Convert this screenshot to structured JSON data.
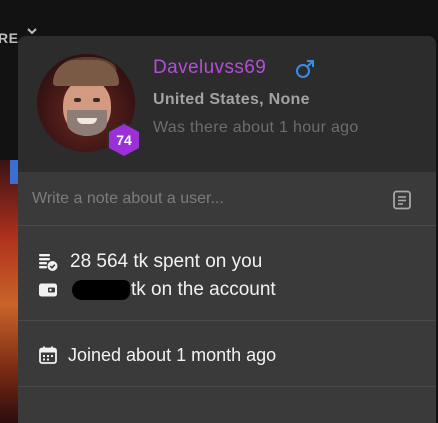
{
  "background": {
    "tab_label": "RE"
  },
  "profile": {
    "username": "Daveluvss69",
    "level": "74",
    "location": "United States, None",
    "last_seen": "Was there about 1 hour ago",
    "gender_icon": "male-symbol-icon",
    "avatar_icon": "user-avatar-photo"
  },
  "note": {
    "placeholder": "Write a note about a user...",
    "value": "",
    "icon": "note-icon"
  },
  "stats": {
    "spent_text": "28 564 tk spent on you",
    "account_suffix": "tk on the account",
    "spent_icon": "coins-icon",
    "account_icon": "wallet-icon"
  },
  "joined": {
    "text": "Joined about 1 month ago",
    "icon": "calendar-icon"
  },
  "colors": {
    "username": "#b54ed8",
    "gender_icon": "#3d8be6",
    "level_badge": "#9b30d9",
    "card_background": "#3a3a3a",
    "header_background": "#2c2c2c"
  }
}
